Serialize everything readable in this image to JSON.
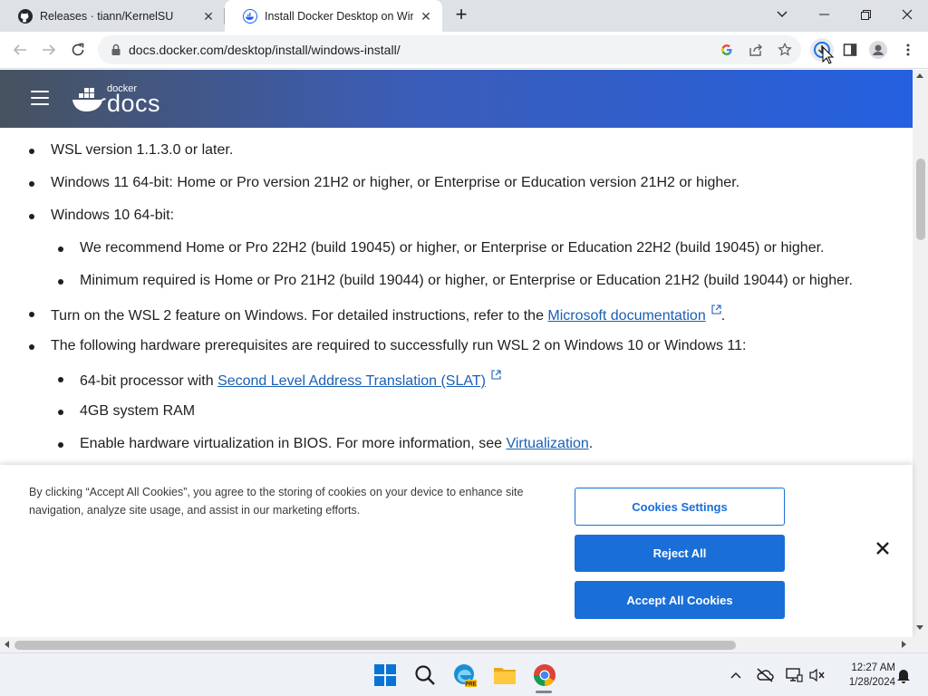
{
  "browser": {
    "tabs": [
      {
        "title": "Releases · tiann/KernelSU",
        "icon": "github-icon"
      },
      {
        "title": "Install Docker Desktop on Windo",
        "icon": "docker-icon"
      }
    ],
    "url": "docs.docker.com/desktop/install/windows-install/"
  },
  "header": {
    "logo_small": "docker",
    "logo_big": "docs"
  },
  "content": {
    "items": [
      {
        "text": "WSL version 1.1.3.0 or later."
      },
      {
        "text": "Windows 11 64-bit: Home or Pro version 21H2 or higher, or Enterprise or Education version 21H2 or higher."
      },
      {
        "text": "Windows 10 64-bit:"
      },
      {
        "text": "We recommend Home or Pro 22H2 (build 19045) or higher, or Enterprise or Education 22H2 (build 19045) or higher."
      },
      {
        "text": "Minimum required is Home or Pro 21H2 (build 19044) or higher, or Enterprise or Education 21H2 (build 19044) or higher."
      },
      {
        "pre": "Turn on the WSL 2 feature on Windows. For detailed instructions, refer to the ",
        "link": "Microsoft documentation",
        "post": "."
      },
      {
        "text": "The following hardware prerequisites are required to successfully run WSL 2 on Windows 10 or Windows 11:"
      },
      {
        "pre": "64-bit processor with ",
        "link": "Second Level Address Translation (SLAT)",
        "post": ""
      },
      {
        "text": "4GB system RAM"
      },
      {
        "pre": "Enable hardware virtualization in BIOS. For more information, see ",
        "link": "Virtualization",
        "post": "."
      }
    ]
  },
  "cookie": {
    "message": "By clicking “Accept All Cookies”, you agree to the storing of cookies on your device to enhance site navigation, analyze site usage, and assist in our marketing efforts.",
    "settings_label": "Cookies Settings",
    "reject_label": "Reject All",
    "accept_label": "Accept All Cookies"
  },
  "taskbar": {
    "time": "12:27 AM",
    "date": "1/28/2024"
  },
  "colors": {
    "link": "#1a5fb4",
    "button": "#1a6ed8",
    "header_start": "#47525f",
    "header_end": "#2560e0"
  }
}
